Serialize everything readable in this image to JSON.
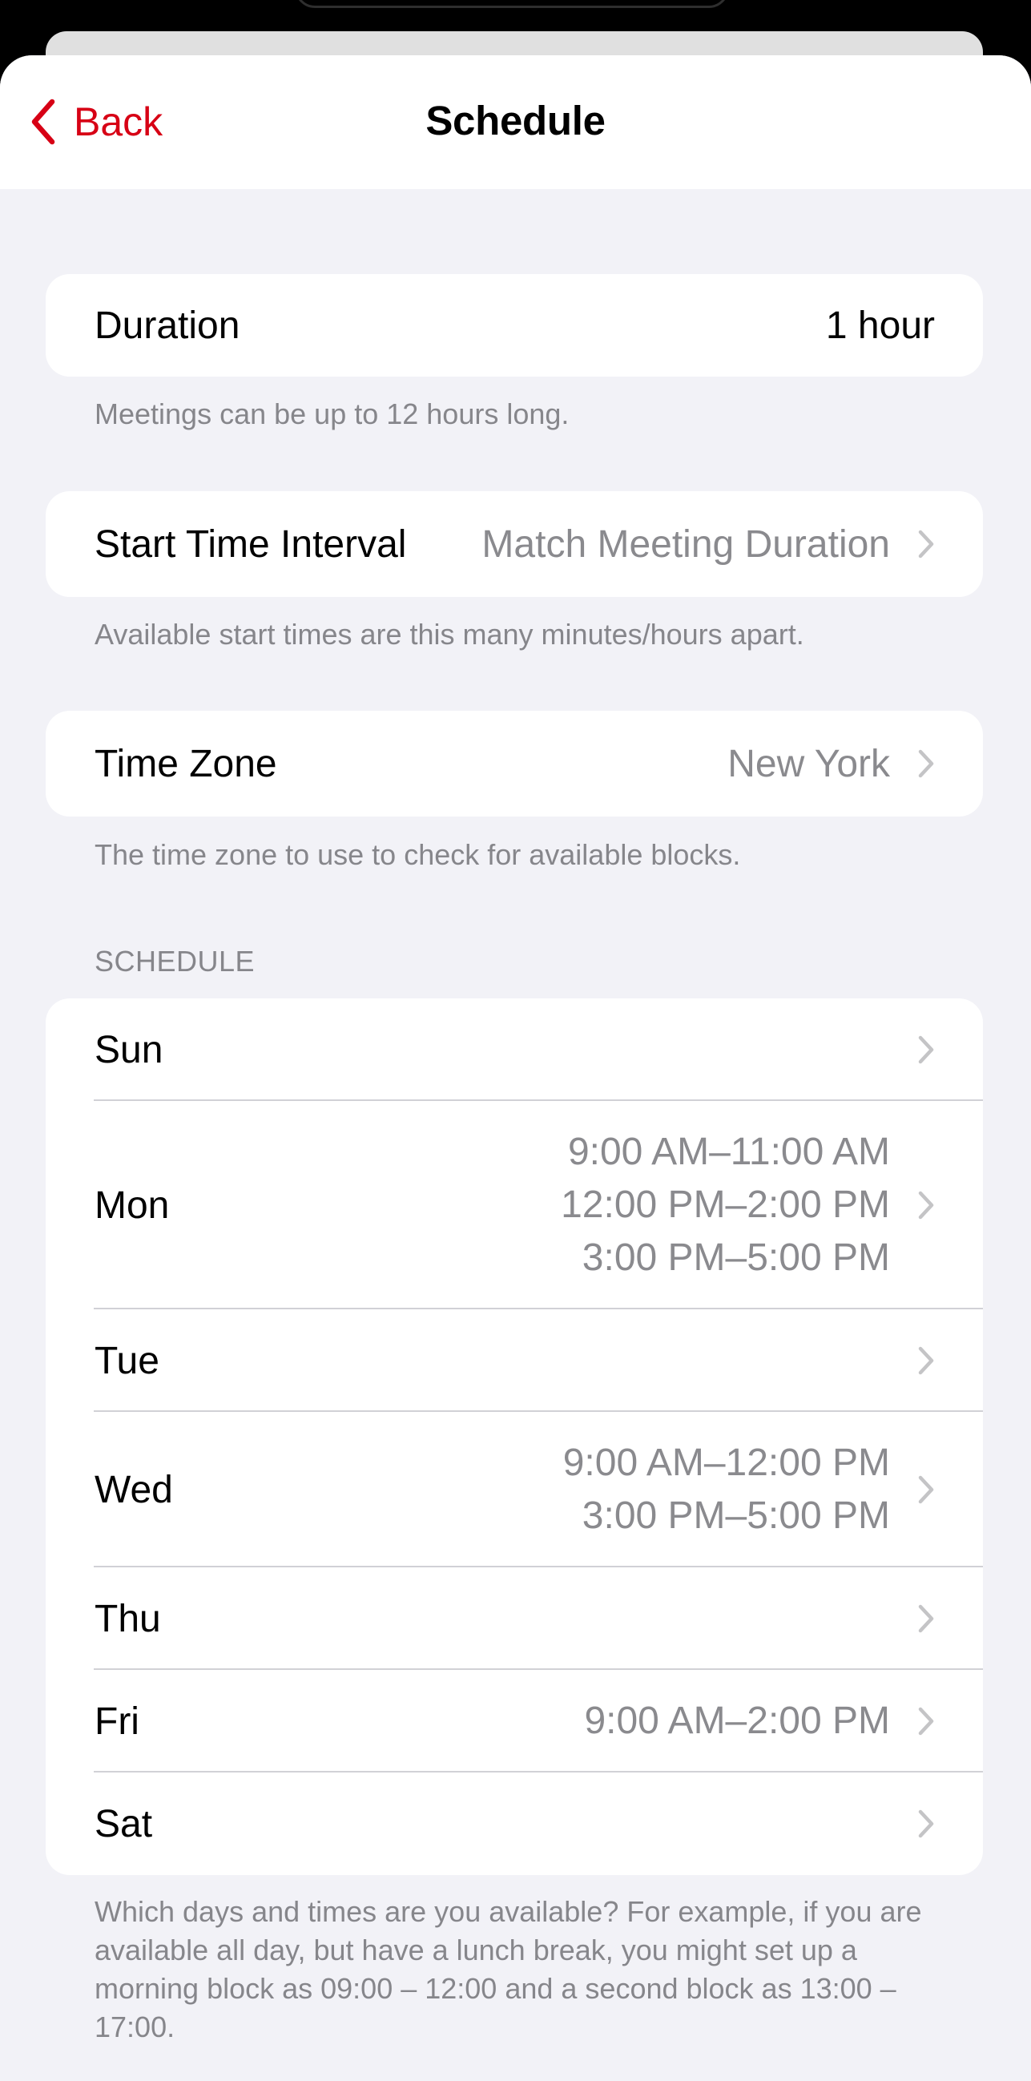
{
  "nav": {
    "back_label": "Back",
    "title": "Schedule"
  },
  "duration": {
    "label": "Duration",
    "value": "1 hour",
    "footnote": "Meetings can be up to 12 hours long."
  },
  "start_time_interval": {
    "label": "Start Time Interval",
    "value": "Match Meeting Duration",
    "footnote": "Available start times are this many minutes/hours apart."
  },
  "time_zone": {
    "label": "Time Zone",
    "value": "New York",
    "footnote": "The time zone to use to check for available blocks."
  },
  "schedule": {
    "header": "SCHEDULE",
    "days": [
      {
        "label": "Sun",
        "blocks": []
      },
      {
        "label": "Mon",
        "blocks": [
          "9:00 AM–11:00 AM",
          "12:00 PM–2:00 PM",
          "3:00 PM–5:00 PM"
        ]
      },
      {
        "label": "Tue",
        "blocks": []
      },
      {
        "label": "Wed",
        "blocks": [
          "9:00 AM–12:00 PM",
          "3:00 PM–5:00 PM"
        ]
      },
      {
        "label": "Thu",
        "blocks": []
      },
      {
        "label": "Fri",
        "blocks": [
          "9:00 AM–2:00 PM"
        ]
      },
      {
        "label": "Sat",
        "blocks": []
      }
    ],
    "footnote": "Which days and times are you available? For example, if you are available all day, but have a lunch break, you might set up a morning block as 09:00 – 12:00 and a second block as 13:00 – 17:00."
  },
  "colors": {
    "accent": "#d70015",
    "background": "#f2f2f7",
    "secondary_text": "#8a8a8e",
    "chevron": "#c4c4c6"
  }
}
